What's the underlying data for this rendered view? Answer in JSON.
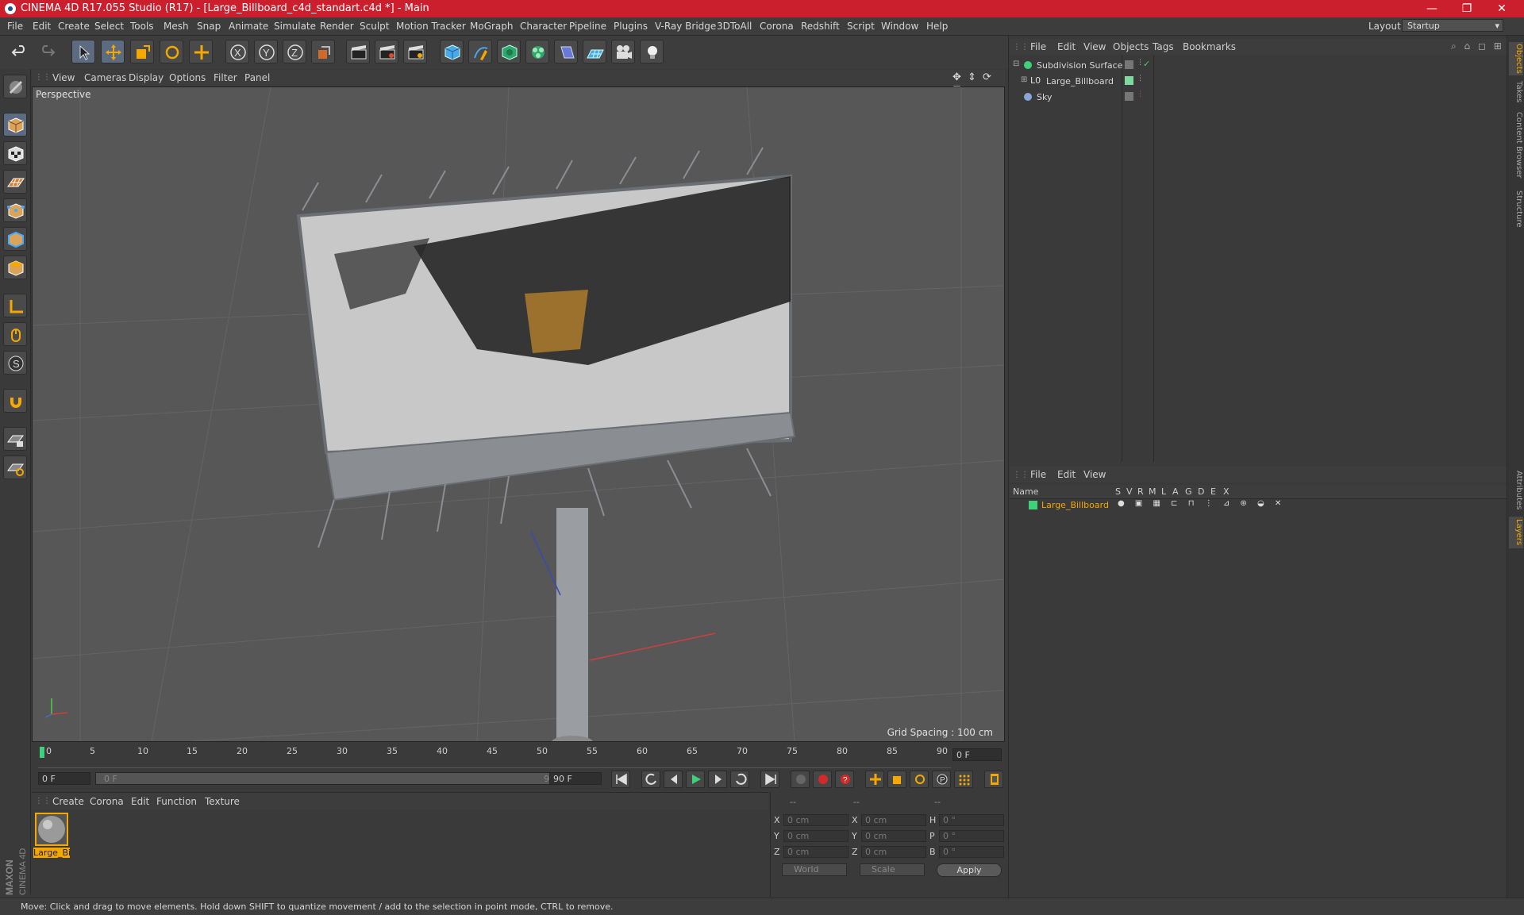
{
  "window": {
    "title": "CINEMA 4D R17.055 Studio (R17) - [Large_Billboard_c4d_standart.c4d *] - Main",
    "minimize": "—",
    "restore": "❐",
    "close": "✕"
  },
  "menubar": {
    "items": [
      "File",
      "Edit",
      "Create",
      "Select",
      "Tools",
      "Mesh",
      "Snap",
      "Animate",
      "Simulate",
      "Render",
      "Sculpt",
      "Motion Tracker",
      "MoGraph",
      "Character",
      "Pipeline",
      "Plugins",
      "V-Ray Bridge",
      "3DToAll",
      "Corona",
      "Redshift",
      "Script",
      "Window",
      "Help"
    ],
    "layout_label": "Layout:",
    "layout_value": "Startup"
  },
  "toolbar": {
    "axis_x": "X",
    "axis_y": "Y",
    "axis_z": "Z"
  },
  "viewport": {
    "menu": [
      "View",
      "Cameras",
      "Display",
      "Options",
      "Filter",
      "Panel"
    ],
    "label": "Perspective",
    "grid_spacing": "Grid Spacing : 100 cm"
  },
  "timeline": {
    "ticks": [
      "0",
      "5",
      "10",
      "15",
      "20",
      "25",
      "30",
      "35",
      "40",
      "45",
      "50",
      "55",
      "60",
      "65",
      "70",
      "75",
      "80",
      "85",
      "90"
    ],
    "current_frame_right": "0 F",
    "start_field": "0 F",
    "range_start": "0 F",
    "range_end": "90 F",
    "end_field": "90 F"
  },
  "material_manager": {
    "menu": [
      "Create",
      "Corona",
      "Edit",
      "Function",
      "Texture"
    ],
    "material_name": "Large_Bi"
  },
  "coordinates": {
    "headers": [
      "--",
      "--",
      "--"
    ],
    "rows": [
      {
        "l1": "X",
        "v1": "0 cm",
        "l2": "X",
        "v2": "0 cm",
        "l3": "H",
        "v3": "0 °"
      },
      {
        "l1": "Y",
        "v1": "0 cm",
        "l2": "Y",
        "v2": "0 cm",
        "l3": "P",
        "v3": "0 °"
      },
      {
        "l1": "Z",
        "v1": "0 cm",
        "l2": "Z",
        "v2": "0 cm",
        "l3": "B",
        "v3": "0 °"
      }
    ],
    "mode_world": "World",
    "mode_scale": "Scale",
    "apply": "Apply"
  },
  "object_manager": {
    "menu": [
      "File",
      "Edit",
      "View",
      "Objects",
      "Tags",
      "Bookmarks"
    ],
    "objects": [
      {
        "name": "Subdivision Surface",
        "color": "#3fd07a"
      },
      {
        "name": "Large_Billboard",
        "color": "#7fd8a0"
      },
      {
        "name": "Sky",
        "color": "#8aa6d6"
      }
    ]
  },
  "layer_manager": {
    "menu": [
      "File",
      "Edit",
      "View"
    ],
    "columns": [
      "Name",
      "S",
      "V",
      "R",
      "M",
      "L",
      "A",
      "G",
      "D",
      "E",
      "X"
    ],
    "layer_name": "Large_Billboard",
    "layer_color": "#3fd07a"
  },
  "right_tabs": [
    "Objects",
    "Takes",
    "Content Browser",
    "Structure",
    "Attributes",
    "Layers"
  ],
  "status": "Move: Click and drag to move elements. Hold down SHIFT to quantize movement / add to the selection in point mode, CTRL to remove.",
  "colors": {
    "accent": "#f5a800",
    "title_bar": "#cc1f2d",
    "selection": "#5c6b80"
  }
}
